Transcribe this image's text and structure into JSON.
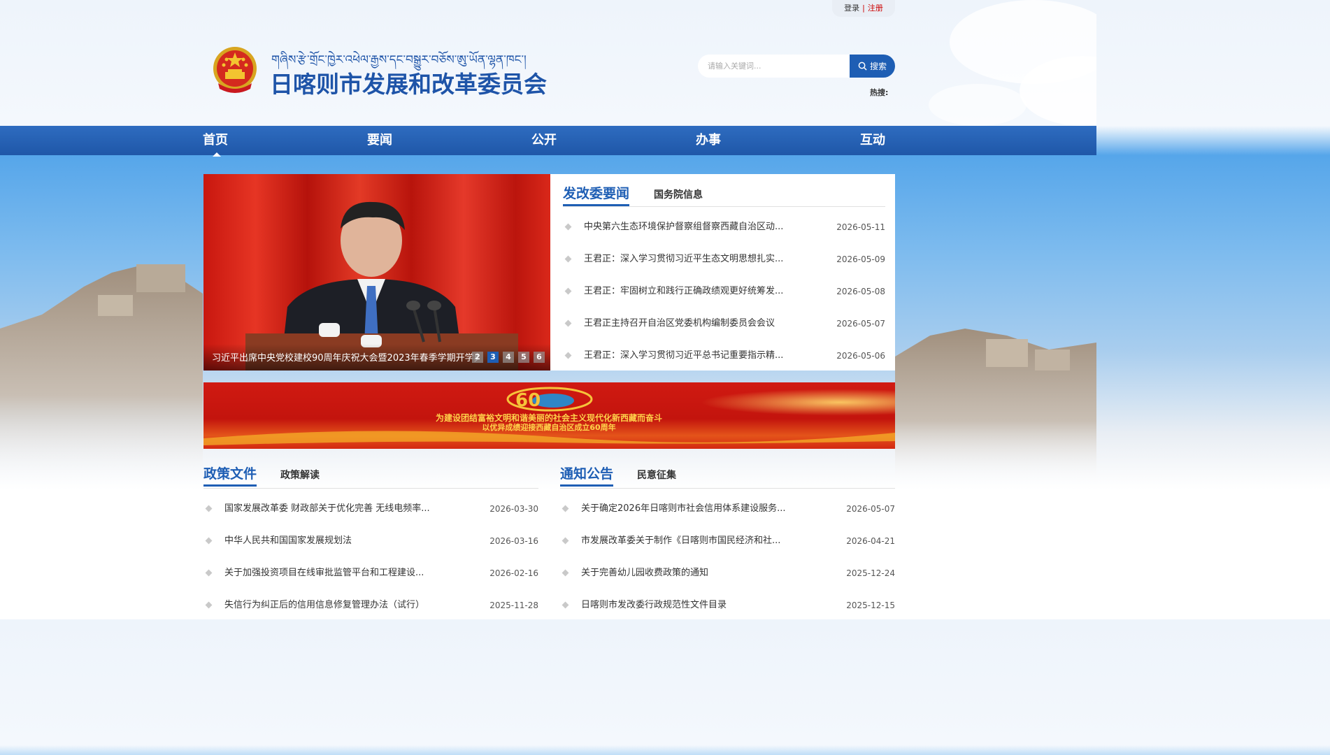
{
  "auth": {
    "login": "登录",
    "separator": "|",
    "register": "注册"
  },
  "header": {
    "tibetan_title": "གཞིས་རྩེ་གྲོང་ཁྱེར་འཕེལ་རྒྱས་དང་བསྒྱུར་བཅོས་ཨུ་ཡོན་ལྷན་ཁང་།",
    "site_title": "日喀则市发展和改革委员会"
  },
  "search": {
    "placeholder": "请输入关键词...",
    "button_label": "搜索",
    "hot_label": "热搜:"
  },
  "nav": {
    "items": [
      {
        "label": "首页"
      },
      {
        "label": "要闻"
      },
      {
        "label": "公开"
      },
      {
        "label": "办事"
      },
      {
        "label": "互动"
      }
    ]
  },
  "slider": {
    "caption": "习近平出席中央党校建校90周年庆祝大会暨2023年春季学期开学典礼",
    "pages": [
      "2",
      "3",
      "4",
      "5",
      "6"
    ],
    "active_page": "3"
  },
  "news": {
    "tabs": [
      "发改委要闻",
      "国务院信息"
    ],
    "items": [
      {
        "title": "中央第六生态环境保护督察组督察西藏自治区动...",
        "date": "2026-05-11"
      },
      {
        "title": "王君正：深入学习贯彻习近平生态文明思想扎实...",
        "date": "2026-05-09"
      },
      {
        "title": "王君正：牢固树立和践行正确政绩观更好统筹发...",
        "date": "2026-05-08"
      },
      {
        "title": "王君正主持召开自治区党委机构编制委员会会议",
        "date": "2026-05-07"
      },
      {
        "title": "王君正：深入学习贯彻习近平总书记重要指示精...",
        "date": "2026-05-06"
      }
    ]
  },
  "banner": {
    "line1": "为建设团结富裕文明和谐美丽的社会主义现代化新西藏而奋斗",
    "line2": "以优异成绩迎接西藏自治区成立60周年",
    "logo_text": "60"
  },
  "policy": {
    "tabs": [
      "政策文件",
      "政策解读"
    ],
    "items": [
      {
        "title": "国家发展改革委 财政部关于优化完善 无线电频率...",
        "date": "2026-03-30"
      },
      {
        "title": "中华人民共和国国家发展规划法",
        "date": "2026-03-16"
      },
      {
        "title": "关于加强投资项目在线审批监管平台和工程建设...",
        "date": "2026-02-16"
      },
      {
        "title": "失信行为纠正后的信用信息修复管理办法（试行）",
        "date": "2025-11-28"
      }
    ]
  },
  "notice": {
    "tabs": [
      "通知公告",
      "民意征集"
    ],
    "items": [
      {
        "title": "关于确定2026年日喀则市社会信用体系建设服务...",
        "date": "2026-05-07"
      },
      {
        "title": "市发展改革委关于制作《日喀则市国民经济和社...",
        "date": "2026-04-21"
      },
      {
        "title": "关于完善幼儿园收费政策的通知",
        "date": "2025-12-24"
      },
      {
        "title": "日喀则市发改委行政规范性文件目录",
        "date": "2025-12-15"
      }
    ]
  },
  "colors": {
    "primary": "#1e5eb4",
    "nav": "#1f57a8",
    "accent_red": "#c00000"
  }
}
